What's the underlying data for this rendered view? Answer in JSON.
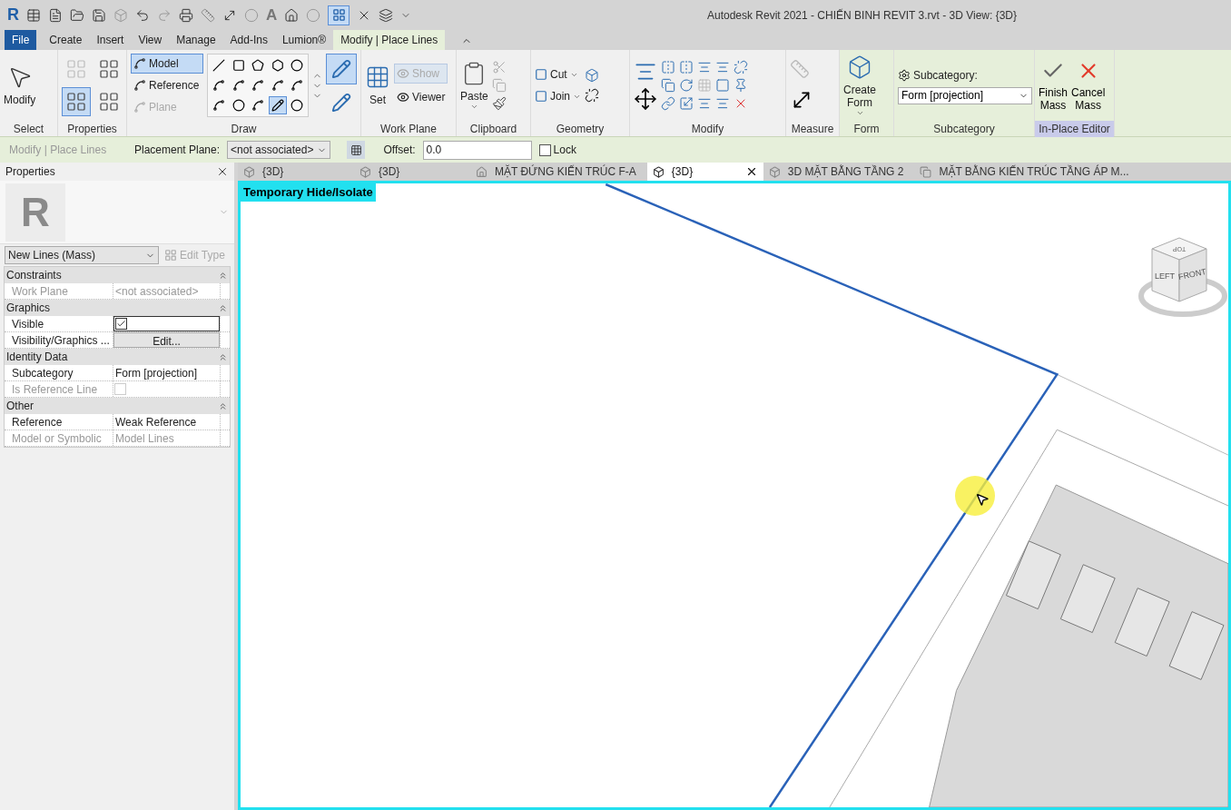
{
  "window": {
    "title": "Autodesk Revit 2021 - CHIẾN BINH REVIT 3.rvt - 3D View: {3D}"
  },
  "quick_access": {
    "logo": "R",
    "text_icon": "A"
  },
  "ribbon_tabs": [
    {
      "label": "File",
      "kind": "file",
      "selected": false
    },
    {
      "label": "Create",
      "kind": "normal",
      "selected": false
    },
    {
      "label": "Insert",
      "kind": "normal",
      "selected": false
    },
    {
      "label": "View",
      "kind": "normal",
      "selected": false
    },
    {
      "label": "Manage",
      "kind": "normal",
      "selected": false
    },
    {
      "label": "Add-Ins",
      "kind": "normal",
      "selected": false
    },
    {
      "label": "Lumion®",
      "kind": "normal",
      "selected": false
    },
    {
      "label": "Modify | Place Lines",
      "kind": "contextual",
      "selected": true
    }
  ],
  "ribbon_panels": [
    {
      "title": "Select",
      "kind": "standard",
      "items": [
        {
          "label": "Modify"
        }
      ]
    },
    {
      "title": "Properties",
      "kind": "standard",
      "toggles": [
        {
          "selected": false
        },
        {
          "selected": false
        },
        {
          "selected": true
        },
        {
          "selected": false
        }
      ]
    },
    {
      "title": "Draw",
      "kind": "standard",
      "items": [
        {
          "label": "Model",
          "selected": true,
          "disabled": false
        },
        {
          "label": "Reference",
          "selected": false,
          "disabled": false
        },
        {
          "label": "Plane",
          "selected": false,
          "disabled": true
        }
      ],
      "tools": [
        {
          "selected": false
        },
        {
          "selected": false
        },
        {
          "selected": false
        },
        {
          "selected": false
        },
        {
          "selected": false
        },
        {
          "selected": false
        },
        {
          "selected": false
        },
        {
          "selected": false
        },
        {
          "selected": false
        },
        {
          "selected": false
        },
        {
          "selected": false
        },
        {
          "selected": false
        },
        {
          "selected": false
        },
        {
          "selected": true
        },
        {
          "selected": false
        }
      ],
      "toggles": [
        {
          "selected": true
        },
        {
          "selected": false
        }
      ]
    },
    {
      "title": "Work Plane",
      "kind": "standard",
      "items": [
        {
          "label": "Set",
          "disabled": false
        },
        {
          "label": "Show",
          "disabled": true
        },
        {
          "label": "Viewer",
          "disabled": false
        }
      ]
    },
    {
      "title": "Clipboard",
      "kind": "standard",
      "items": [
        {
          "label": "Paste"
        }
      ]
    },
    {
      "title": "Geometry",
      "kind": "standard",
      "items": [
        {
          "label": "Cut"
        },
        {
          "label": "Join"
        }
      ]
    },
    {
      "title": "Modify",
      "kind": "standard"
    },
    {
      "title": "Measure",
      "kind": "standard"
    },
    {
      "title": "Form",
      "kind": "contextual",
      "items": [
        {
          "label": "Create Form"
        }
      ]
    },
    {
      "title": "Subcategory",
      "kind": "contextual",
      "items": [
        {
          "label": "Subcategory:"
        },
        {
          "label": "Form [projection]"
        }
      ]
    },
    {
      "title": "In-Place Editor",
      "kind": "editor",
      "items": [
        {
          "label": "Finish Mass"
        },
        {
          "label": "Cancel Mass"
        }
      ]
    }
  ],
  "options_bar": {
    "context": "Modify | Place Lines",
    "placement_label": "Placement Plane:",
    "placement_value": "<not associated>",
    "offset_label": "Offset:",
    "offset_value": "0.0",
    "lock": {
      "label": "Lock",
      "checked": false
    }
  },
  "properties": {
    "title": "Properties",
    "preview_glyph": "R",
    "type": "New Lines (Mass)",
    "edit_type": "Edit Type",
    "groups": [
      {
        "name": "Constraints",
        "rows": [
          {
            "name": "Work Plane",
            "value": "<not associated>",
            "kind": "text",
            "disabled": true
          }
        ]
      },
      {
        "name": "Graphics",
        "rows": [
          {
            "name": "Visible",
            "kind": "checkbox",
            "checked": true,
            "disabled": false
          },
          {
            "name": "Visibility/Graphics ...",
            "value": "Edit...",
            "kind": "button",
            "disabled": false
          }
        ]
      },
      {
        "name": "Identity Data",
        "rows": [
          {
            "name": "Subcategory",
            "value": "Form [projection]",
            "kind": "text",
            "disabled": false
          },
          {
            "name": "Is Reference Line",
            "kind": "checkbox",
            "checked": false,
            "disabled": true
          }
        ]
      },
      {
        "name": "Other",
        "rows": [
          {
            "name": "Reference",
            "value": "Weak Reference",
            "kind": "text",
            "disabled": false
          },
          {
            "name": "Model or Symbolic",
            "value": "Model Lines",
            "kind": "text",
            "disabled": true
          }
        ]
      }
    ]
  },
  "view_tabs": [
    {
      "label": "{3D}",
      "kind": "model",
      "selected": false
    },
    {
      "label": "{3D}",
      "kind": "model",
      "selected": false
    },
    {
      "label": "MẶT ĐỨNG KIẾN TRÚC F-A",
      "kind": "elevation",
      "selected": false
    },
    {
      "label": "{3D}",
      "kind": "model",
      "selected": true
    },
    {
      "label": "3D MẶT BẰNG TẦNG 2",
      "kind": "model",
      "selected": false
    },
    {
      "label": "MẶT BẰNG KIẾN TRÚC TẦNG ÁP M...",
      "kind": "sheet",
      "selected": false
    }
  ],
  "viewport": {
    "banner": "Temporary Hide/Isolate",
    "viewcube": {
      "top": "TOP",
      "left": "LEFT",
      "front": "FRONT"
    }
  }
}
